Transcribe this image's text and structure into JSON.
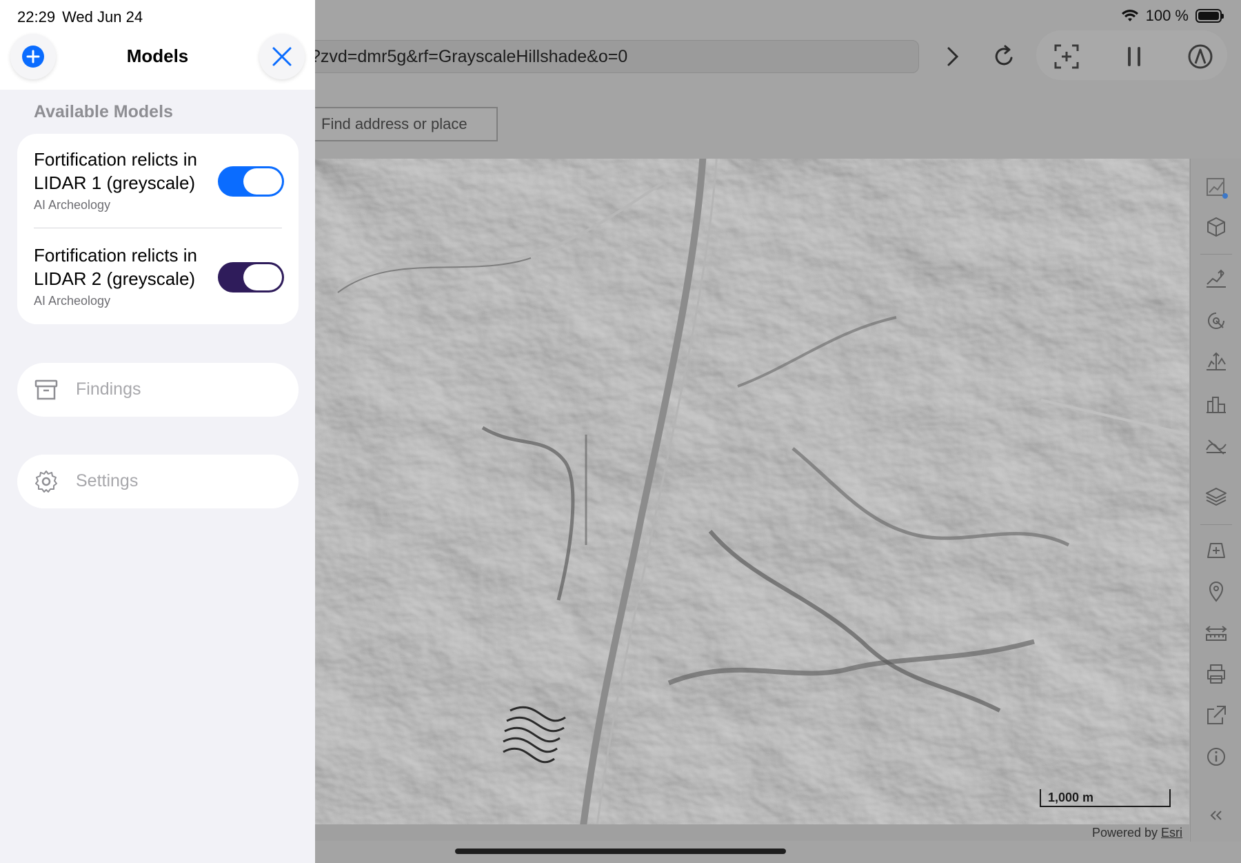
{
  "status": {
    "time": "22:29",
    "date": "Wed Jun 24",
    "battery": "100 %",
    "battery_level": 1.0
  },
  "browser": {
    "url": "?zvd=dmr5g&rf=GrayscaleHillshade&o=0",
    "icons": [
      "forward-icon",
      "reload-icon",
      "screenshot-icon",
      "pause-icon",
      "compass-icon"
    ]
  },
  "map": {
    "search_placeholder": "Find address or place",
    "scale_label": "1,000 m",
    "attribution_prefix": "Powered by ",
    "attribution_link": "Esri",
    "tool_icons": [
      "chart-icon",
      "cube-icon",
      "elevation-icon",
      "viewshed-icon",
      "measure-height-icon",
      "buildings-icon",
      "profile-icon",
      "layers-icon",
      "add-view-icon",
      "pin-icon",
      "measure-distance-icon",
      "print-icon",
      "share-icon",
      "info-icon",
      "collapse-icon"
    ]
  },
  "sheet": {
    "title": "Models",
    "section_heading": "Available Models",
    "models": [
      {
        "name_line1": "Fortification relicts in",
        "name_line2": "LIDAR 1 (greyscale)",
        "provider": "AI Archeology",
        "enabled": true,
        "color": "#0a6cff"
      },
      {
        "name_line1": "Fortification relicts in",
        "name_line2": "LIDAR 2 (greyscale)",
        "provider": "AI Archeology",
        "enabled": true,
        "color": "#2f1c5b"
      }
    ],
    "findings_label": "Findings",
    "settings_label": "Settings"
  }
}
